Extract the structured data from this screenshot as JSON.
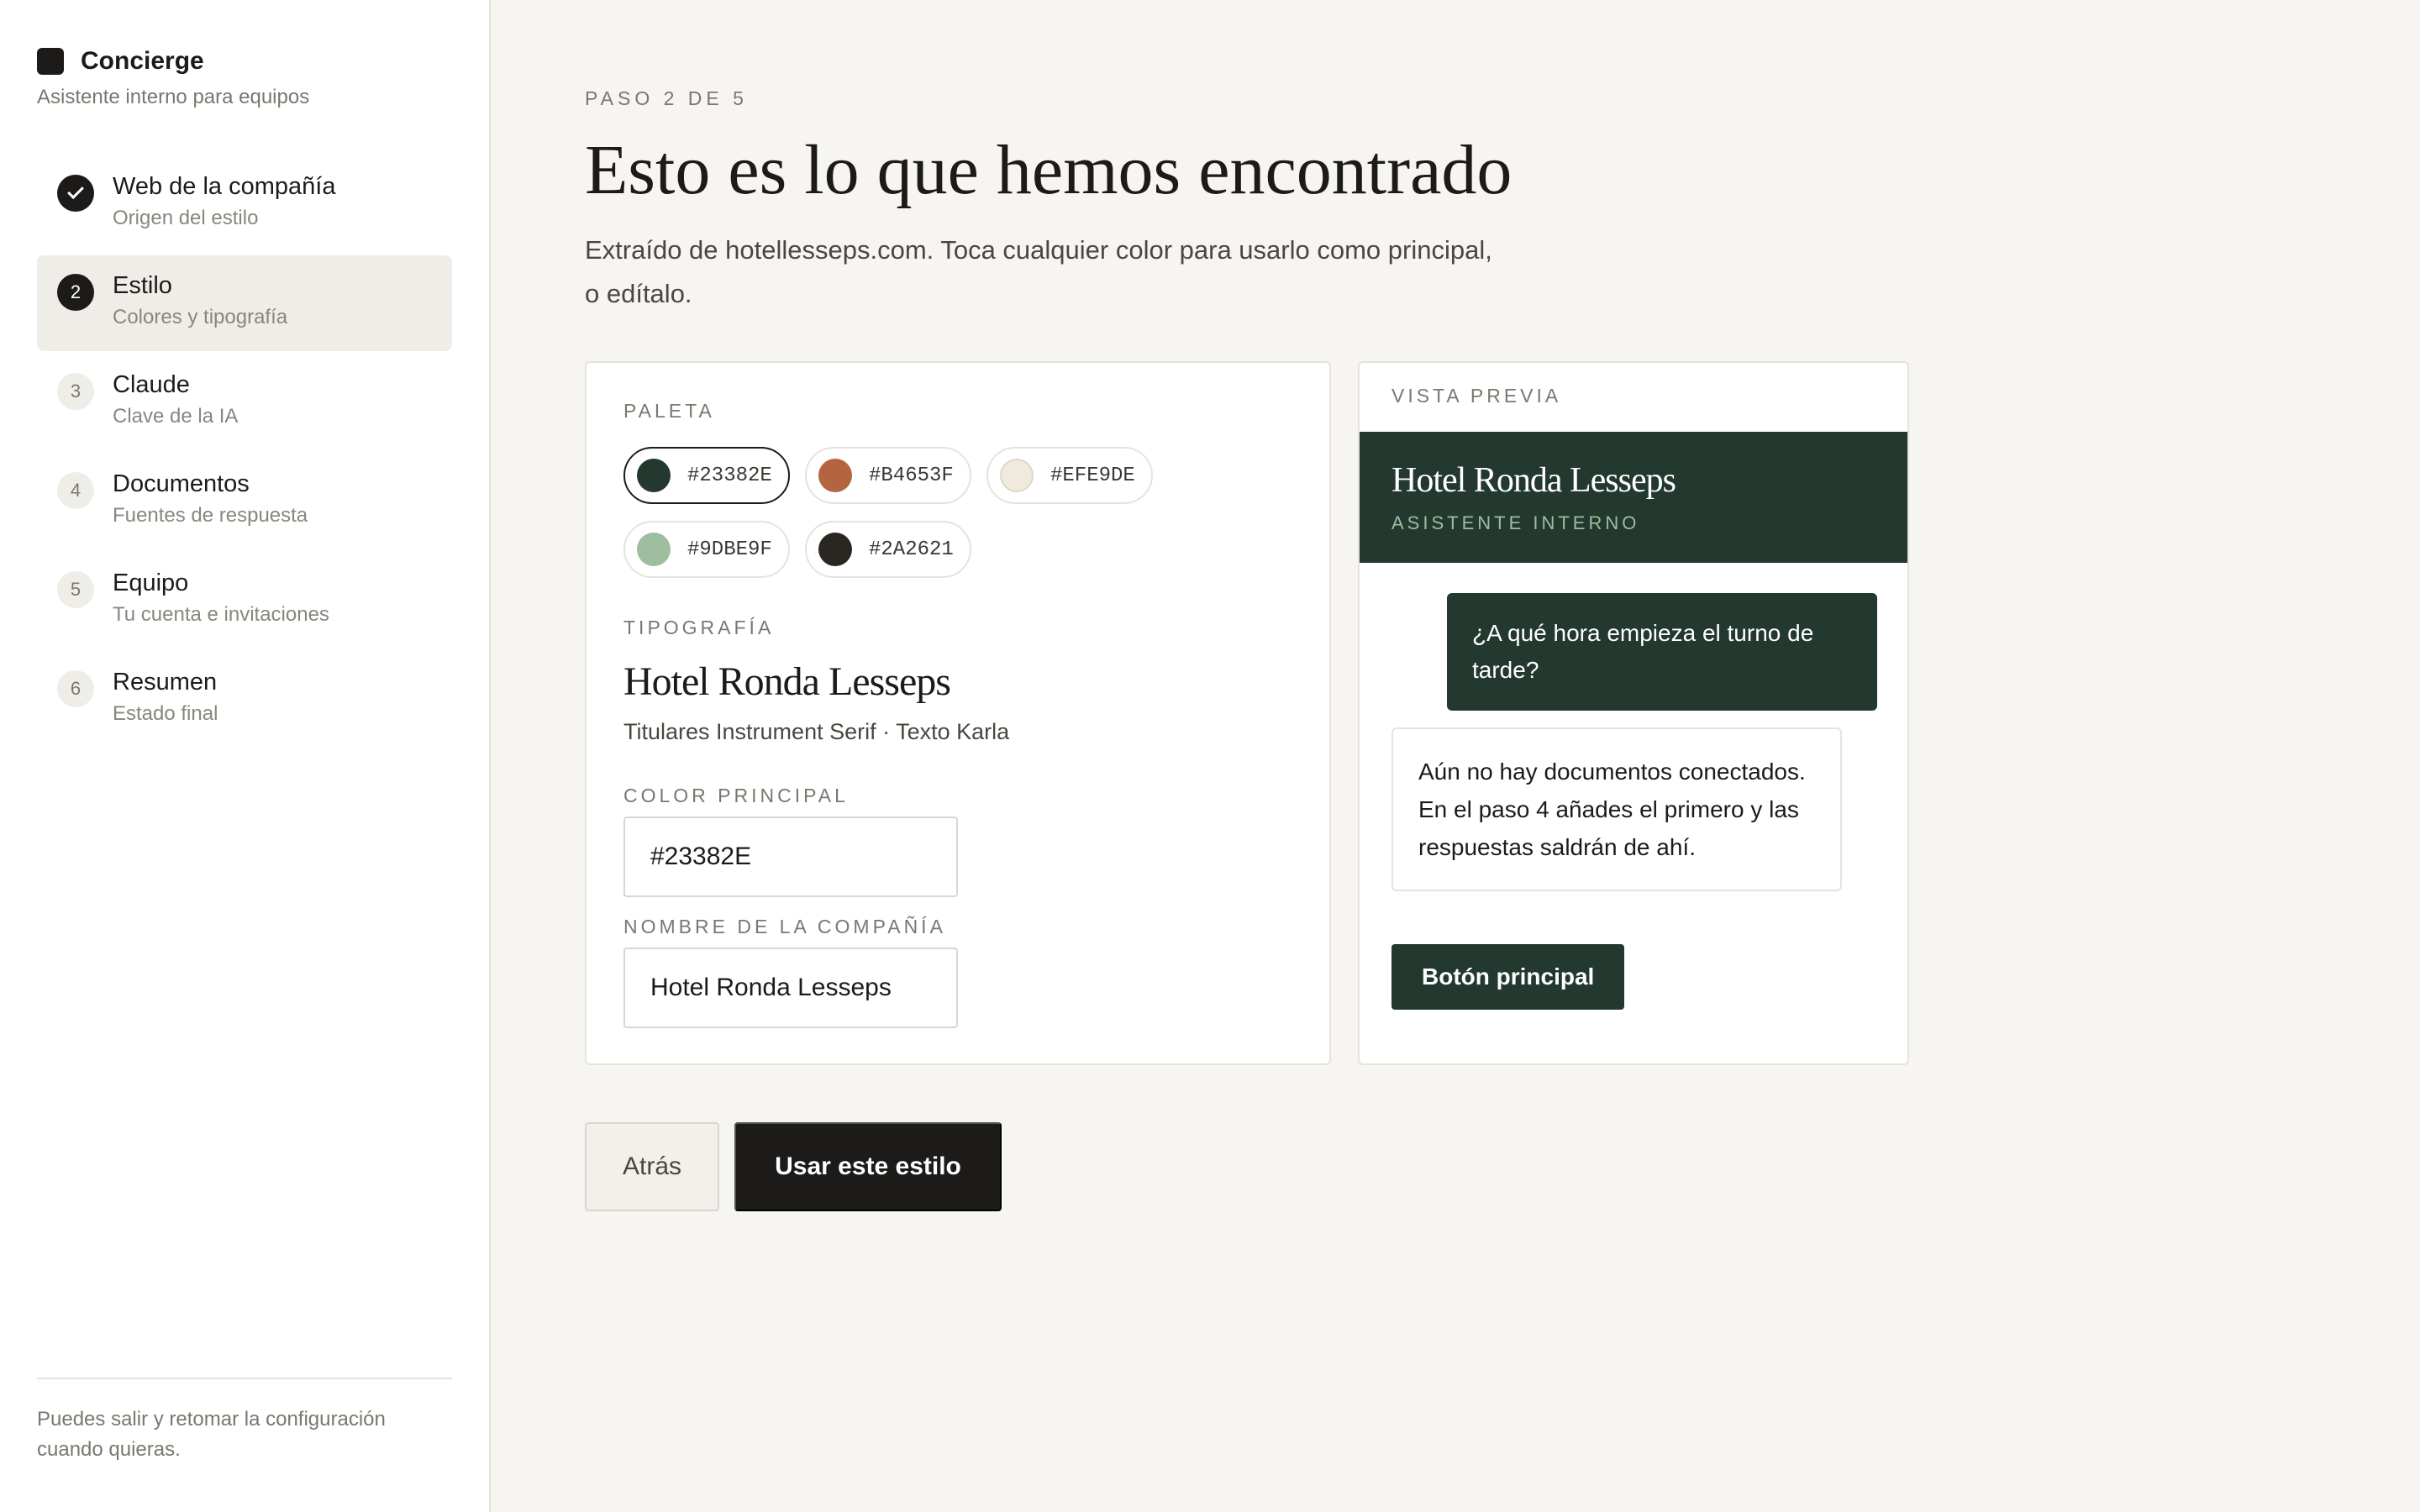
{
  "brand": {
    "name": "Concierge",
    "subtitle": "Asistente interno para equipos"
  },
  "steps": [
    {
      "num": "",
      "title": "Web de la compañía",
      "sub": "Origen del estilo",
      "state": "done"
    },
    {
      "num": "2",
      "title": "Estilo",
      "sub": "Colores y tipografía",
      "state": "active"
    },
    {
      "num": "3",
      "title": "Claude",
      "sub": "Clave de la IA",
      "state": "todo"
    },
    {
      "num": "4",
      "title": "Documentos",
      "sub": "Fuentes de respuesta",
      "state": "todo"
    },
    {
      "num": "5",
      "title": "Equipo",
      "sub": "Tu cuenta e invitaciones",
      "state": "todo"
    },
    {
      "num": "6",
      "title": "Resumen",
      "sub": "Estado final",
      "state": "todo"
    }
  ],
  "sidebar_footer": "Puedes salir y retomar la configuración cuando quieras.",
  "header": {
    "eyebrow": "PASO 2 DE 5",
    "title": "Esto es lo que hemos encontrado",
    "lede": "Extraído de hotellesseps.com. Toca cualquier color para usarlo como principal, o edítalo."
  },
  "palette": {
    "label": "PALETA",
    "swatches": [
      {
        "hex": "#23382E",
        "color": "#23382e",
        "selected": true
      },
      {
        "hex": "#B4653F",
        "color": "#b4653f",
        "selected": false
      },
      {
        "hex": "#EFE9DE",
        "color": "#efe9de",
        "selected": false
      },
      {
        "hex": "#9DBE9F",
        "color": "#9dbe9f",
        "selected": false
      },
      {
        "hex": "#2A2621",
        "color": "#2a2621",
        "selected": false
      }
    ]
  },
  "typography": {
    "label": "TIPOGRAFÍA",
    "sample": "Hotel Ronda Lesseps",
    "meta": "Titulares Instrument Serif · Texto Karla"
  },
  "primary_color": {
    "label": "COLOR PRINCIPAL",
    "value": "#23382E"
  },
  "company_name": {
    "label": "NOMBRE DE LA COMPAÑÍA",
    "value": "Hotel Ronda Lesseps"
  },
  "preview": {
    "label": "VISTA PREVIA",
    "brand": "Hotel Ronda Lesseps",
    "brand_sub": "ASISTENTE INTERNO",
    "user_message": "¿A qué hora empieza el turno de tarde?",
    "bot_message": "Aún no hay documentos conectados. En el paso 4 añades el primero y las respuestas saldrán de ahí.",
    "button": "Botón principal"
  },
  "actions": {
    "back": "Atrás",
    "primary": "Usar este estilo"
  }
}
